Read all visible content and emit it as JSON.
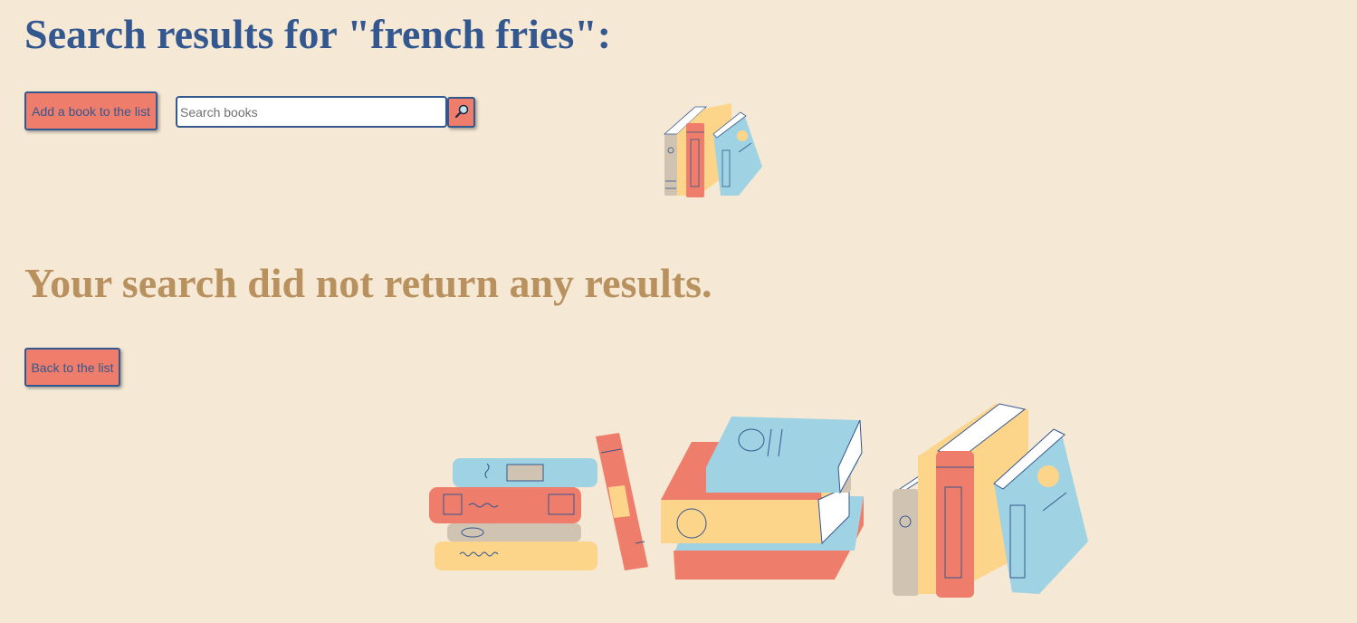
{
  "header": {
    "title": "Search results for \"french fries\":"
  },
  "toolbar": {
    "add_book_label": "Add a book to the list",
    "search_placeholder": "Search books",
    "search_value": "",
    "search_icon": "magnifier-icon"
  },
  "results": {
    "empty_message": "Your search did not return any results.",
    "back_label": "Back to the list"
  },
  "colors": {
    "background": "#f5e8d5",
    "accent": "#ef7d6b",
    "primary": "#33578f",
    "muted_heading": "#b8915e"
  }
}
